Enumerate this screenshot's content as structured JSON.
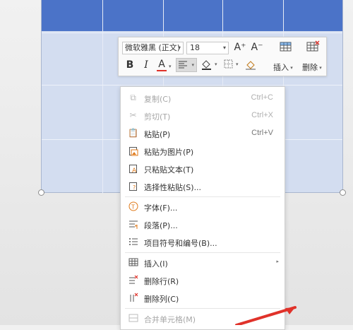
{
  "toolbar": {
    "font_name": "微软雅黑 (正文)",
    "font_size": "18",
    "grow_font": "A⁺",
    "shrink_font": "A⁻",
    "bold": "B",
    "italic": "I",
    "font_color": "A",
    "insert_label": "插入",
    "delete_label": "删除"
  },
  "menu": {
    "items": [
      {
        "label": "复制(C)",
        "shortcut": "Ctrl+C",
        "icon": "copy-icon"
      },
      {
        "label": "剪切(T)",
        "shortcut": "Ctrl+X",
        "icon": "cut-icon"
      },
      {
        "label": "粘贴(P)",
        "shortcut": "Ctrl+V",
        "icon": "paste-icon"
      },
      {
        "label": "粘贴为图片(P)",
        "icon": "paste-picture-icon"
      },
      {
        "label": "只粘贴文本(T)",
        "icon": "paste-text-icon"
      },
      {
        "label": "选择性粘贴(S)...",
        "icon": "paste-special-icon"
      },
      {
        "label": "字体(F)...",
        "icon": "font-icon"
      },
      {
        "label": "段落(P)...",
        "icon": "paragraph-icon"
      },
      {
        "label": "项目符号和编号(B)...",
        "icon": "bullets-icon"
      },
      {
        "label": "插入(I)",
        "icon": "insert-table-icon"
      },
      {
        "label": "删除行(R)",
        "icon": "delete-row-icon"
      },
      {
        "label": "删除列(C)",
        "icon": "delete-column-icon"
      },
      {
        "label": "合并单元格(M)",
        "icon": "merge-cells-icon"
      }
    ]
  },
  "colors": {
    "header_row": "#4b73c8",
    "table_body": "#d3ddf0",
    "annotation_arrow": "#e0322a"
  }
}
